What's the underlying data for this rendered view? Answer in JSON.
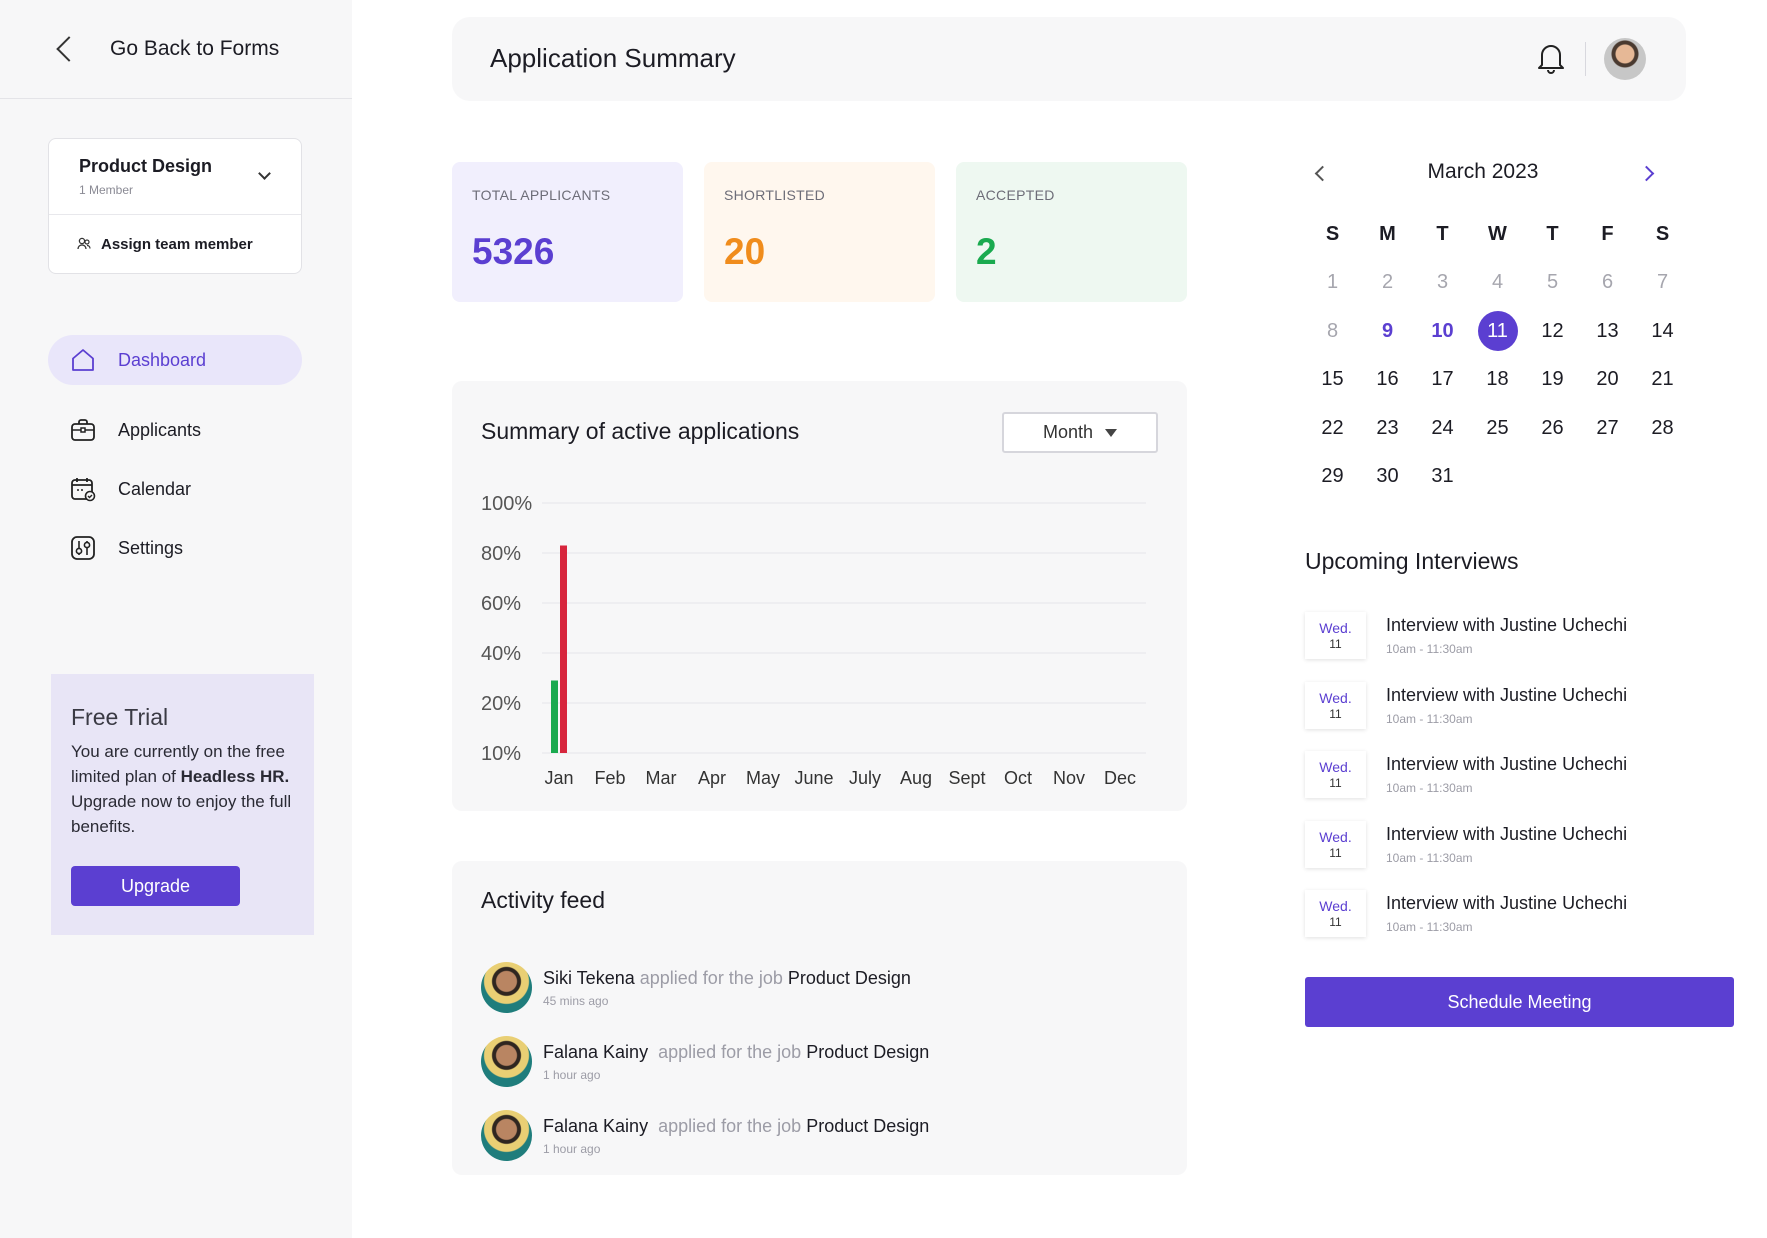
{
  "sidebar": {
    "back_label": "Go Back to Forms",
    "team": {
      "name": "Product Design",
      "members": "1 Member",
      "assign_label": "Assign team member"
    },
    "nav": [
      {
        "label": "Dashboard",
        "icon": "home-icon",
        "active": true
      },
      {
        "label": "Applicants",
        "icon": "briefcase-icon",
        "active": false
      },
      {
        "label": "Calendar",
        "icon": "calendar-icon",
        "active": false
      },
      {
        "label": "Settings",
        "icon": "settings-icon",
        "active": false
      }
    ],
    "trial": {
      "title": "Free Trial",
      "text_before": "You are currently on the free limited plan of ",
      "brand": "Headless HR.",
      "text_after": " Upgrade now to enjoy the full benefits.",
      "button": "Upgrade"
    }
  },
  "header": {
    "title": "Application Summary"
  },
  "stats": {
    "total": {
      "label": "TOTAL APPLICANTS",
      "value": "5326"
    },
    "shortlisted": {
      "label": "SHORTLISTED",
      "value": "20"
    },
    "accepted": {
      "label": "ACCEPTED",
      "value": "2"
    }
  },
  "chart_card": {
    "title": "Summary of active  applications",
    "period": "Month"
  },
  "chart_data": {
    "type": "bar",
    "categories": [
      "Jan",
      "Feb",
      "Mar",
      "Apr",
      "May",
      "June",
      "July",
      "Aug",
      "Sept",
      "Oct",
      "Nov",
      "Dec"
    ],
    "y_ticks": [
      "100%",
      "80%",
      "60%",
      "40%",
      "20%",
      "10%"
    ],
    "series": [
      {
        "color": "#1aaa4f",
        "values": [
          29,
          null,
          null,
          null,
          null,
          null,
          null,
          null,
          null,
          null,
          null,
          null
        ]
      },
      {
        "color": "#d7263d",
        "values": [
          83,
          null,
          null,
          null,
          null,
          null,
          null,
          null,
          null,
          null,
          null,
          null
        ]
      }
    ],
    "grid": true
  },
  "activity": {
    "title": "Activity feed",
    "items": [
      {
        "name": "Siki Tekena",
        "middle": "applied for the job",
        "job": "Product Design",
        "time": "45 mins ago"
      },
      {
        "name": "Falana Kainy",
        "middle": "applied for the job",
        "job": "Product Design",
        "time": "1 hour ago"
      },
      {
        "name": "Falana Kainy",
        "middle": "applied for the job",
        "job": "Product Design",
        "time": "1 hour ago"
      }
    ]
  },
  "calendar": {
    "month": "March 2023",
    "weekdays": [
      "S",
      "M",
      "T",
      "W",
      "T",
      "F",
      "S"
    ],
    "weeks": [
      [
        "1",
        "2",
        "3",
        "4",
        "5",
        "6",
        "7"
      ],
      [
        "8",
        "9",
        "10",
        "11",
        "12",
        "13",
        "14"
      ],
      [
        "15",
        "16",
        "17",
        "18",
        "19",
        "20",
        "21"
      ],
      [
        "22",
        "23",
        "24",
        "25",
        "26",
        "27",
        "28"
      ],
      [
        "29",
        "30",
        "31",
        "",
        "",
        "",
        ""
      ]
    ],
    "today": "11",
    "highlighted": [
      "9",
      "10"
    ],
    "muted": [
      "1",
      "2",
      "3",
      "4",
      "5",
      "6",
      "7",
      "8"
    ]
  },
  "interviews": {
    "title": "Upcoming Interviews",
    "items": [
      {
        "day": "Wed.",
        "date": "11",
        "title": "Interview with Justine Uchechi",
        "time": "10am - 11:30am"
      },
      {
        "day": "Wed.",
        "date": "11",
        "title": "Interview with Justine Uchechi",
        "time": "10am - 11:30am"
      },
      {
        "day": "Wed.",
        "date": "11",
        "title": "Interview with Justine Uchechi",
        "time": "10am - 11:30am"
      },
      {
        "day": "Wed.",
        "date": "11",
        "title": "Interview with Justine Uchechi",
        "time": "10am - 11:30am"
      },
      {
        "day": "Wed.",
        "date": "11",
        "title": "Interview with Justine Uchechi",
        "time": "10am - 11:30am"
      }
    ],
    "schedule_button": "Schedule Meeting"
  }
}
